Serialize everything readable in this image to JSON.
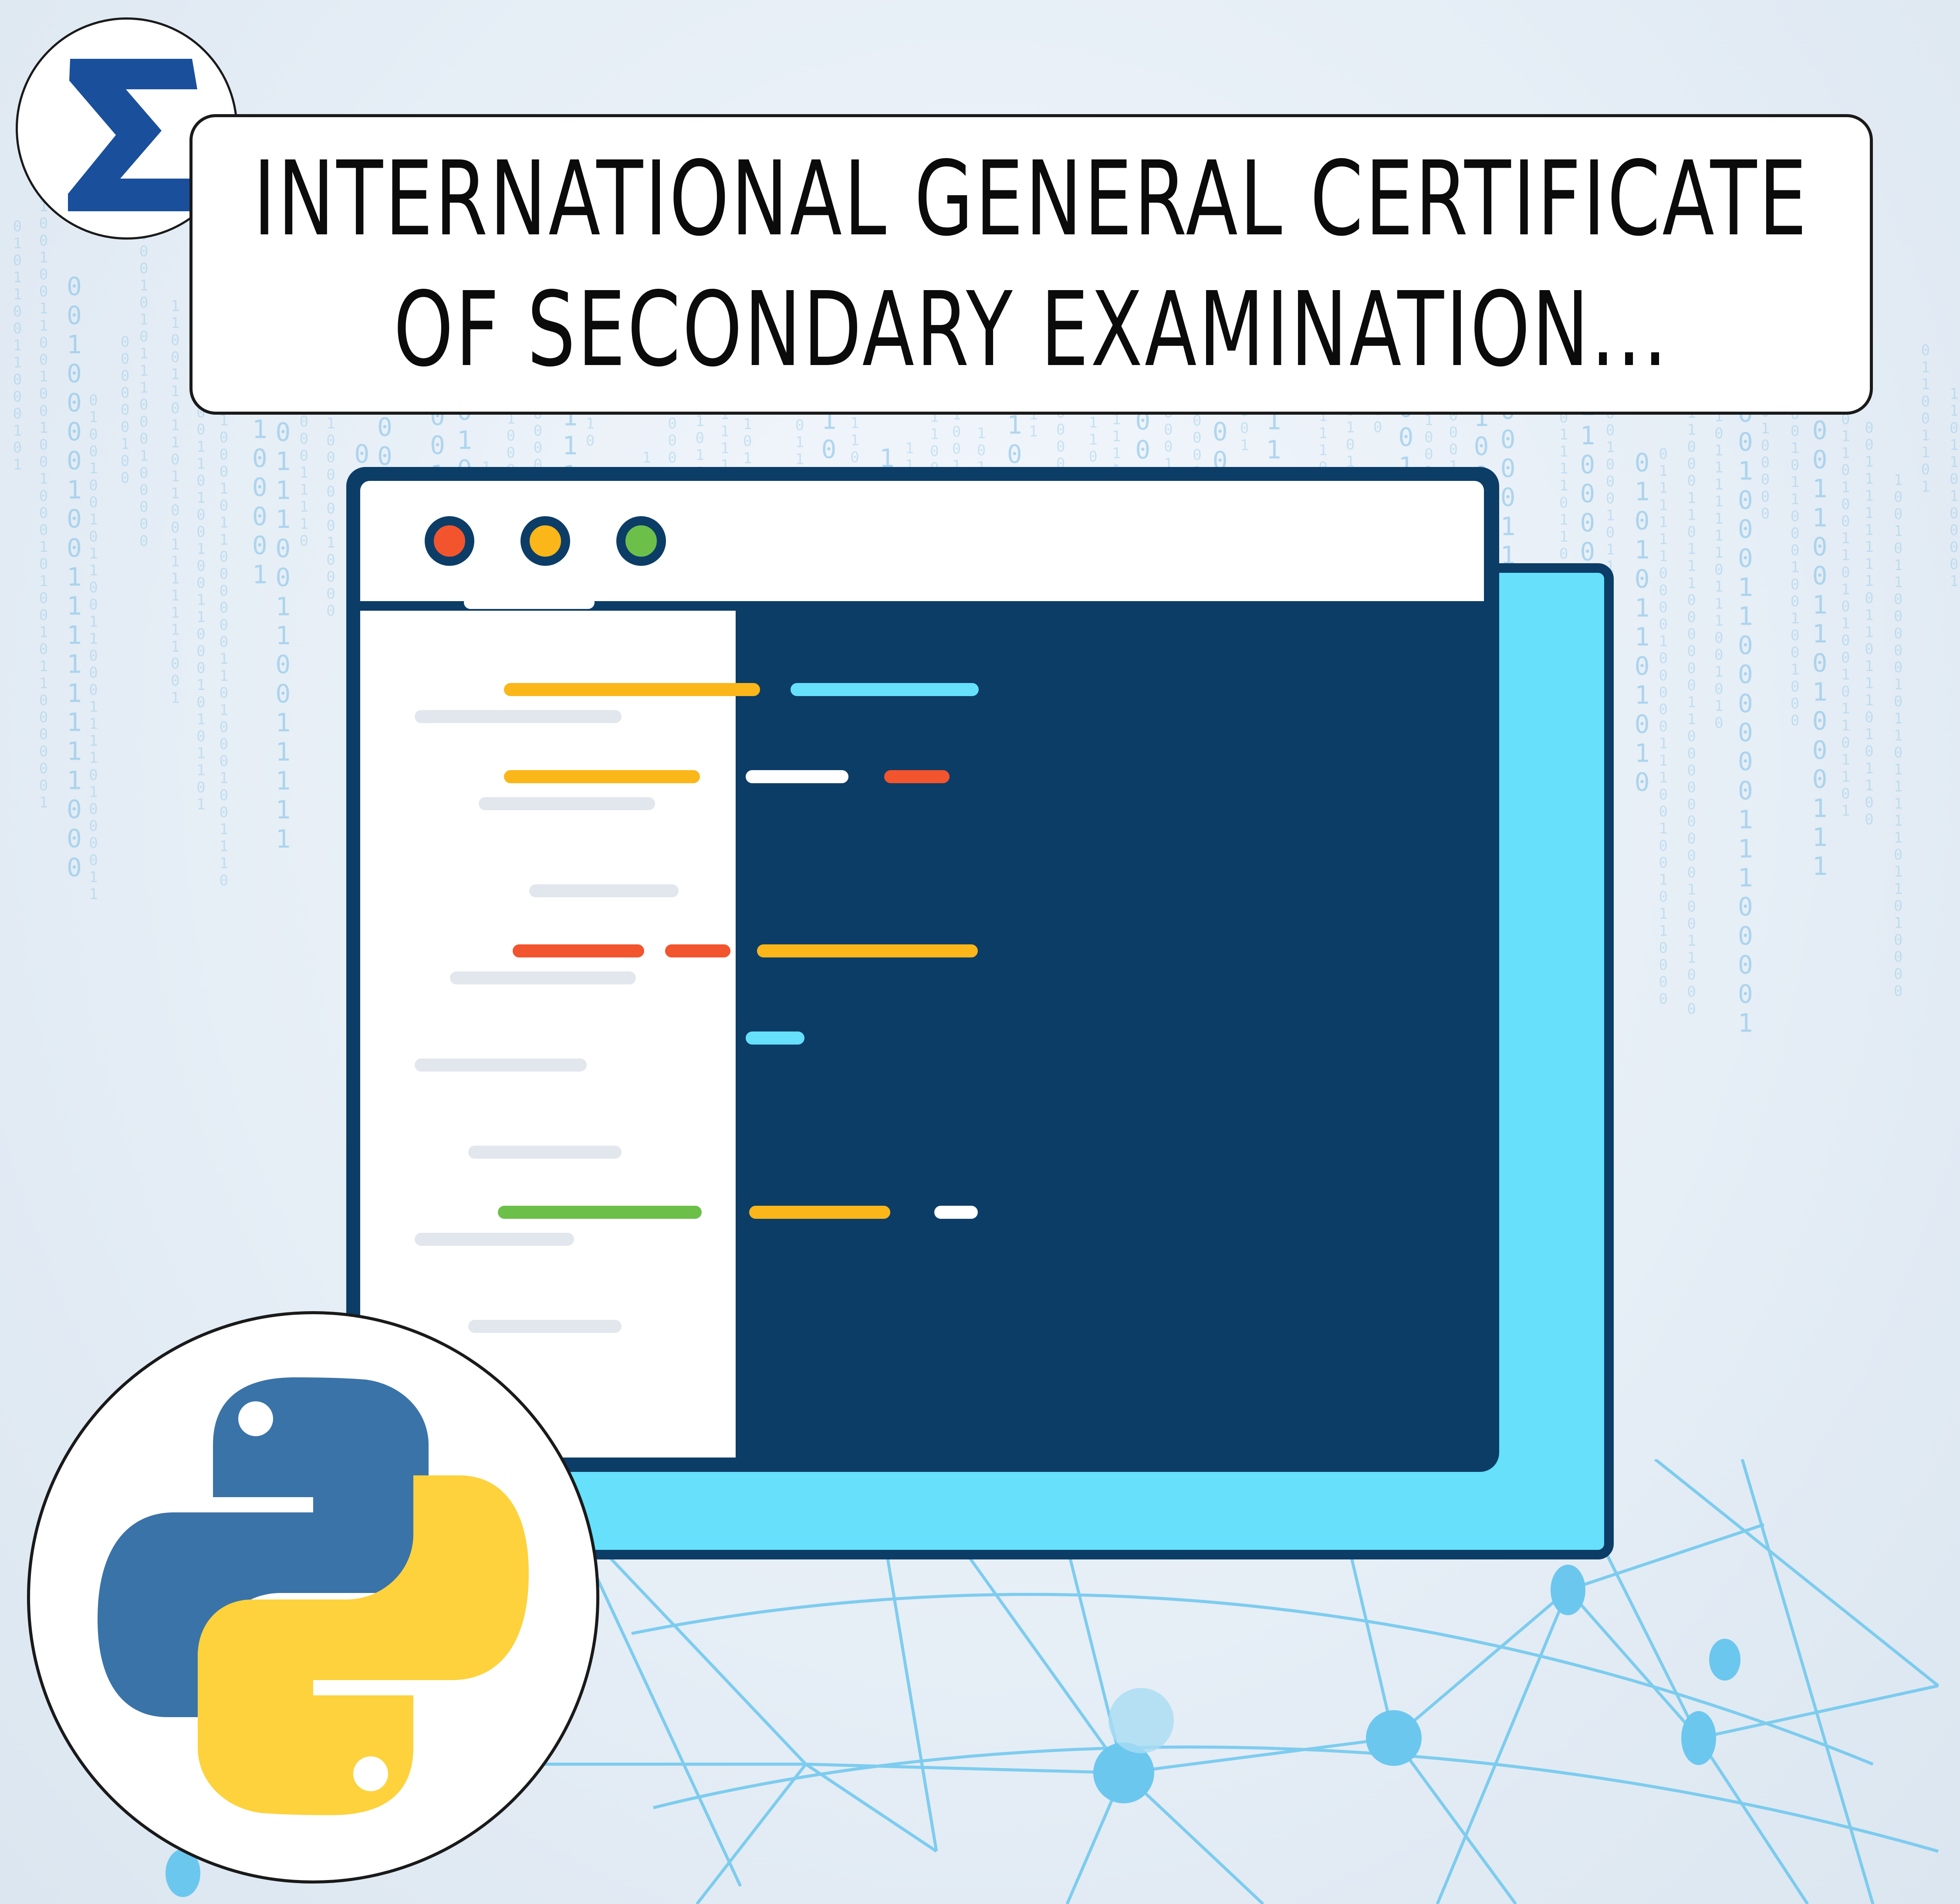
{
  "title": {
    "line1": "INTERNATIONAL GENERAL CERTIFICATE",
    "line2": "OF SECONDARY EXAMINATION..."
  },
  "logo": {
    "icon": "sigma-pi-logo-icon",
    "letters": "Σπ"
  },
  "editor": {
    "window_dots": [
      {
        "name": "close",
        "color": "#f2542d"
      },
      {
        "name": "minimize",
        "color": "#fbb619"
      },
      {
        "name": "maximize",
        "color": "#6cc04a"
      }
    ],
    "colors": {
      "frame": "#0c3d67",
      "back_window": "#66e0fb",
      "code_white": "#ffffff",
      "code_yellow": "#fbb619",
      "code_cyan": "#66e0fb",
      "code_red": "#f2542d",
      "code_green": "#6cc04a"
    }
  },
  "python_logo": {
    "icon": "python-logo-icon",
    "colors": {
      "blue": "#3a73a8",
      "yellow": "#fdd23c"
    }
  }
}
